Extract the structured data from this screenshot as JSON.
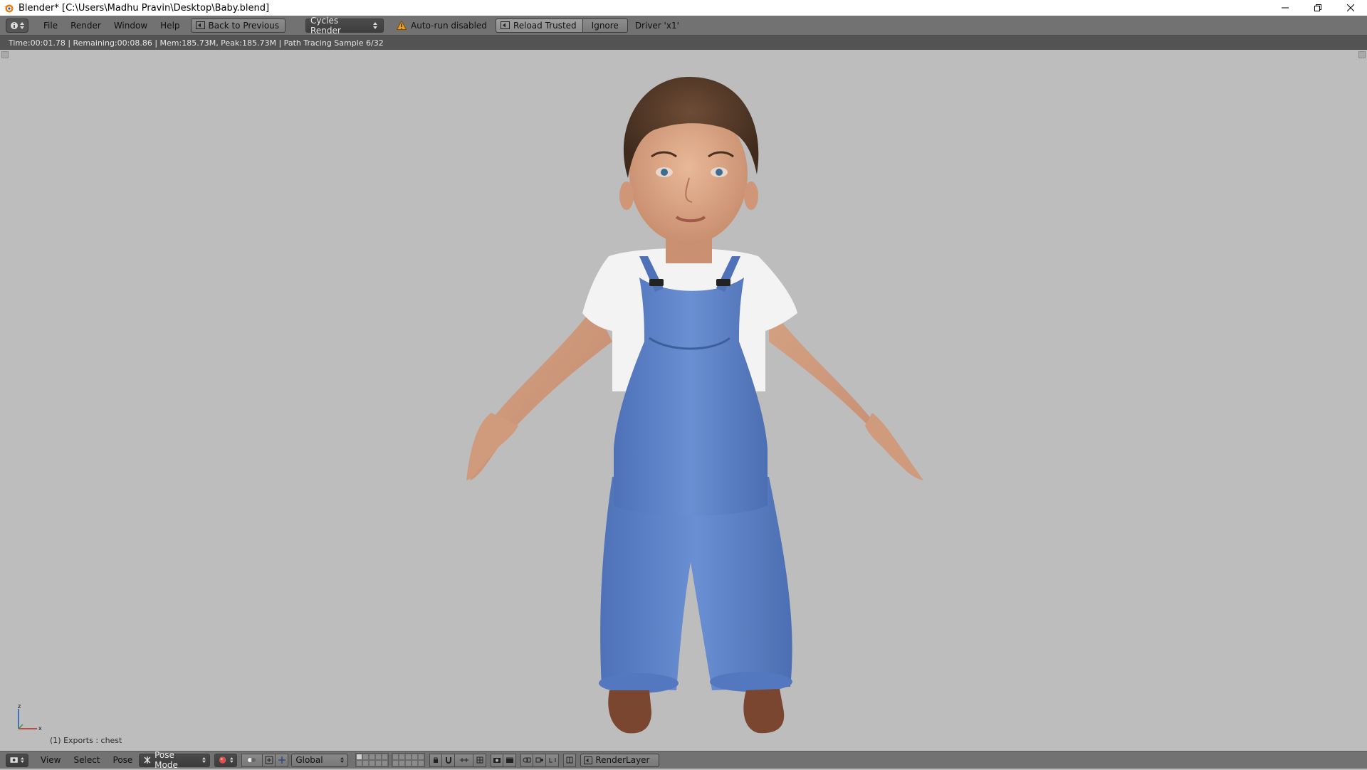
{
  "window": {
    "title": "Blender* [C:\\Users\\Madhu Pravin\\Desktop\\Baby.blend]",
    "controls": [
      "minimize-icon",
      "restore-icon",
      "close-icon"
    ]
  },
  "info_header": {
    "menus": [
      "File",
      "Render",
      "Window",
      "Help"
    ],
    "back_button": "Back to Previous",
    "render_engine": "Cycles Render",
    "warning": "Auto-run disabled",
    "reload_trusted": "Reload Trusted",
    "ignore": "Ignore",
    "driver": "Driver 'x1'"
  },
  "render_status": "Time:00:01.78 | Remaining:00:08.86 | Mem:185.73M, Peak:185.73M | Path Tracing Sample 6/32",
  "viewport": {
    "object_label": "(1) Exports : chest",
    "axis_labels": {
      "z": "z",
      "x": "x"
    }
  },
  "footer": {
    "menus": [
      "View",
      "Select",
      "Pose"
    ],
    "mode": "Pose Mode",
    "orientation": "Global",
    "render_layer": "RenderLayer"
  },
  "colors": {
    "header_bg": "#727272",
    "viewport_bg": "#bdbdbd",
    "status_bg": "#535353",
    "overalls_blue": "#5b7fc6",
    "shirt_white": "#f2f2f2",
    "skin": "#d9a586",
    "hair": "#5a3e2b",
    "shoes": "#7a4630"
  }
}
